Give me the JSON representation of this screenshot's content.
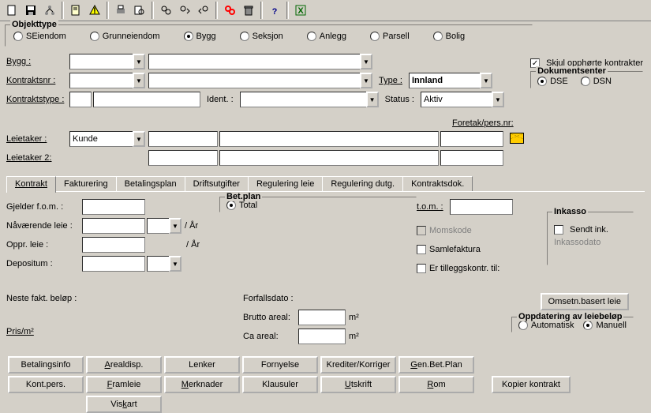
{
  "toolbar_icons": [
    "new",
    "save",
    "tree",
    "doc",
    "warn",
    "print",
    "preview",
    "find",
    "find-next",
    "find-prev",
    "find-stop",
    "delete",
    "help",
    "excel"
  ],
  "objekttype": {
    "label": "Objekttype",
    "options": [
      "SEiendom",
      "Grunneiendom",
      "Bygg",
      "Seksjon",
      "Anlegg",
      "Parsell",
      "Bolig"
    ],
    "selected": "Bygg"
  },
  "labels": {
    "bygg": "Bygg :",
    "kontraktsnr": "Kontraktsnr :",
    "kontraktstype": "Kontraktstype :",
    "ident": "Ident. :",
    "type": "Type :",
    "status": "Status :",
    "leietaker": "Leietaker :",
    "leietaker2": "Leietaker 2:",
    "foretak": "Foretak/pers.nr:",
    "skjul": "Skjul opphørte kontrakter",
    "dokumentsenter": "Dokumentsenter",
    "dse": "DSE",
    "dsn": "DSN"
  },
  "values": {
    "type": "Innland",
    "status": "Aktiv",
    "leietaker_type": "Kunde",
    "skjul_checked": true,
    "dok_selected": "DSE"
  },
  "tabs": [
    "Kontrakt",
    "Fakturering",
    "Betalingsplan",
    "Driftsutgifter",
    "Regulering leie",
    "Regulering dutg.",
    "Kontraktsdok."
  ],
  "active_tab": "Kontrakt",
  "kontrakt": {
    "gjelder_fom": "Gjelder f.o.m. :",
    "navarende_leie": "Nåværende leie :",
    "oppr_leie": "Oppr. leie :",
    "depositum": "Depositum :",
    "per_ar": "/ År",
    "betplan": "Bet.plan",
    "total": "Total",
    "tom": "t.o.m. :",
    "momskode": "Momskode",
    "samlefaktura": "Samlefaktura",
    "tillegg": "Er tilleggskontr. til:",
    "inkasso": "Inkasso",
    "sendt_ink": "Sendt ink.",
    "inkassodato": "Inkassodato",
    "omsetn": "Omsetn.basert leie",
    "oppdatering": "Oppdatering av leiebeløp",
    "automatisk": "Automatisk",
    "manuell": "Manuell",
    "oppdatering_sel": "Manuell",
    "neste_fakt": "Neste fakt. beløp :",
    "forfallsdato": "Forfallsdato :",
    "brutto_areal": "Brutto areal:",
    "ca_areal": "Ca areal:",
    "pris_m2": "Pris/m²",
    "unit_m2": "m²"
  },
  "buttons": {
    "betalingsinfo": "Betalingsinfo",
    "arealdisp": "Arealdisp.",
    "lenker": "Lenker",
    "fornyelse": "Fornyelse",
    "krediter": "Krediter/Korriger",
    "genbetplan": "Gen.Bet.Plan",
    "kontpers": "Kont.pers.",
    "framleie": "Framleie",
    "merknader": "Merknader",
    "klausuler": "Klausuler",
    "utskrift": "Utskrift",
    "rom": "Rom",
    "kopier": "Kopier kontrakt",
    "viskart": "Vis kart"
  }
}
